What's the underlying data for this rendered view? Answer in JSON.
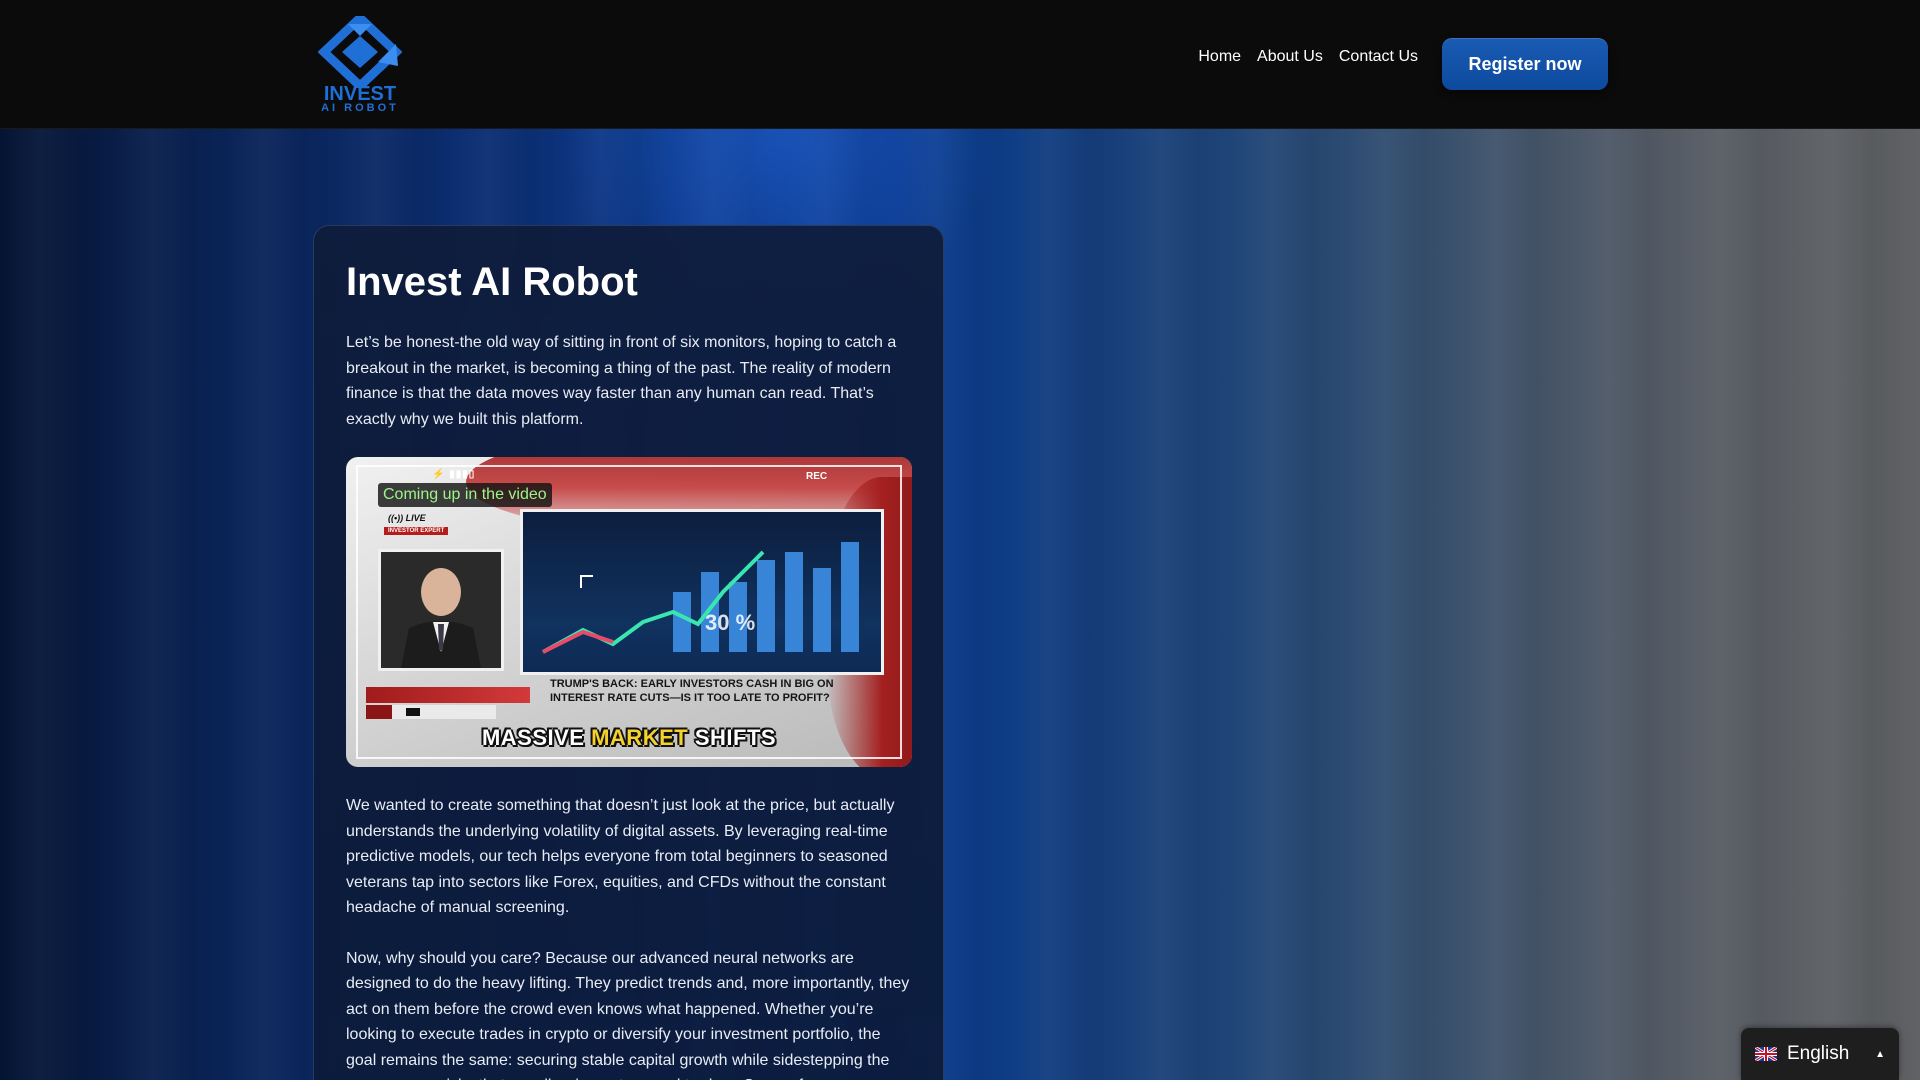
{
  "brand": {
    "logo_line1": "INVEST",
    "logo_line2": "AI ROBOT",
    "accent_color": "#1f6fd6"
  },
  "nav": {
    "items": [
      "Home",
      "About Us",
      "Contact Us"
    ],
    "cta_label": "Register now"
  },
  "main": {
    "title": "Invest AI Robot",
    "paragraphs": [
      "Let’s be honest-the old way of sitting in front of six monitors, hoping to catch a breakout in the market, is becoming a thing of the past. The reality of modern finance is that the data moves way faster than any human can read. That’s exactly why we built this platform.",
      "We wanted to create something that doesn’t just look at the price, but actually understands the underlying volatility of digital assets. By leveraging real-time predictive models, our tech helps everyone from total beginners to seasoned veterans tap into sectors like Forex, equities, and CFDs without the constant headache of manual screening.",
      "Now, why should you care? Because our advanced neural networks are designed to do the heavy lifting. They predict trends and, more importantly, they act on them before the crowd even knows what happened. Whether you’re looking to execute trades in crypto or diversify your investment portfolio, the goal remains the same: securing stable capital growth while sidestepping the unnecessary risks that usually wipe out manual traders. Some of our users"
    ],
    "video": {
      "overlay_label": "Coming up in the video",
      "live_label": "((•)) LIVE",
      "expert_label": "INVESTOR EXPERT",
      "rec_label": "REC",
      "headline": "TRUMP'S BACK: EARLY INVESTORS CASH IN BIG ON INTEREST RATE CUTS—IS IT TOO LATE TO PROFIT?",
      "caption_a": "MASSIVE",
      "caption_b": "MARKET",
      "caption_c": "SHIFTS",
      "chart_percent": "30 %"
    }
  },
  "language": {
    "selected": "English",
    "flag": "uk-flag-icon",
    "caret": "▲"
  }
}
